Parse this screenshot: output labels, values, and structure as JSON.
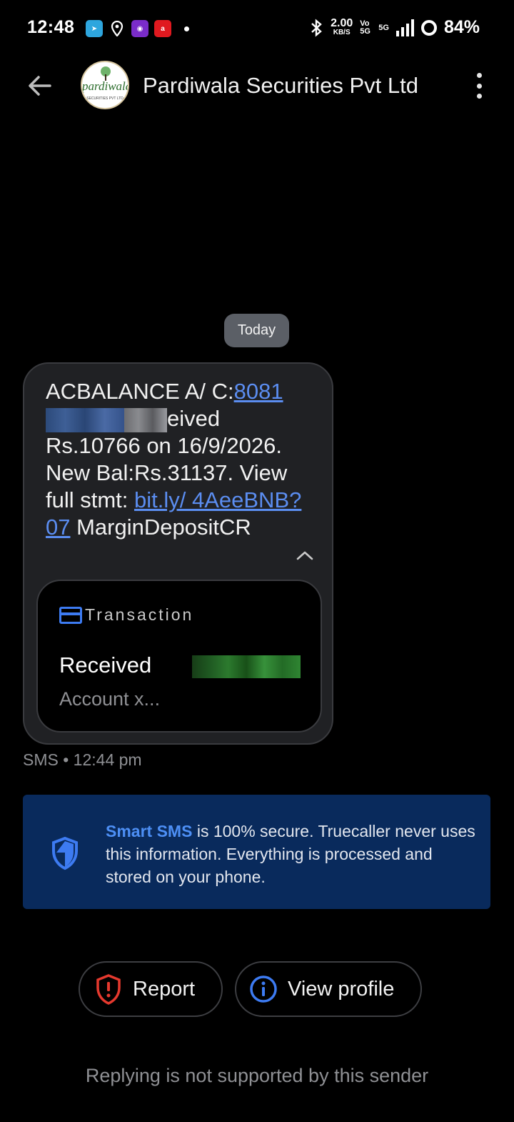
{
  "status_bar": {
    "time": "12:48",
    "net_speed": "2.00",
    "net_unit": "KB/S",
    "volte": "Vo 5G",
    "network": "5G",
    "battery": "84%",
    "icons": [
      "telegram-icon",
      "location-icon",
      "app-icon",
      "airtel-icon",
      "notification-dot-icon",
      "bluetooth-icon",
      "signal-icon",
      "battery-icon"
    ]
  },
  "header": {
    "sender_name": "Pardiwala Securities Pvt Ltd",
    "avatar_text": "pardiwala",
    "avatar_subtext": "SECURITIES PVT LTD"
  },
  "date_chip": "Today",
  "message": {
    "part1": "ACBALANCE A/ C:",
    "account_link": "8081",
    "part2": "eived Rs.10766 on 16/9/2026. New Bal:Rs.31137. View full stmt: ",
    "url": "bit.ly/ 4AeeBNB?07",
    "part3": " MarginDepositCR",
    "card": {
      "label": "Transaction",
      "status": "Received",
      "account": "Account x..."
    },
    "meta": "SMS • 12:44 pm"
  },
  "smart_sms": {
    "highlight": "Smart SMS",
    "text": " is 100% secure. Truecaller never uses this information. Everything is processed and stored on your phone."
  },
  "buttons": {
    "report": "Report",
    "view_profile": "View profile"
  },
  "footer": "Replying is not supported by this sender",
  "colors": {
    "background": "#000000",
    "bubble": "#202124",
    "link": "#5b8df0",
    "accent_blue": "#3d7bf2",
    "info_bg": "#092a5c",
    "report_red": "#e5392e"
  }
}
